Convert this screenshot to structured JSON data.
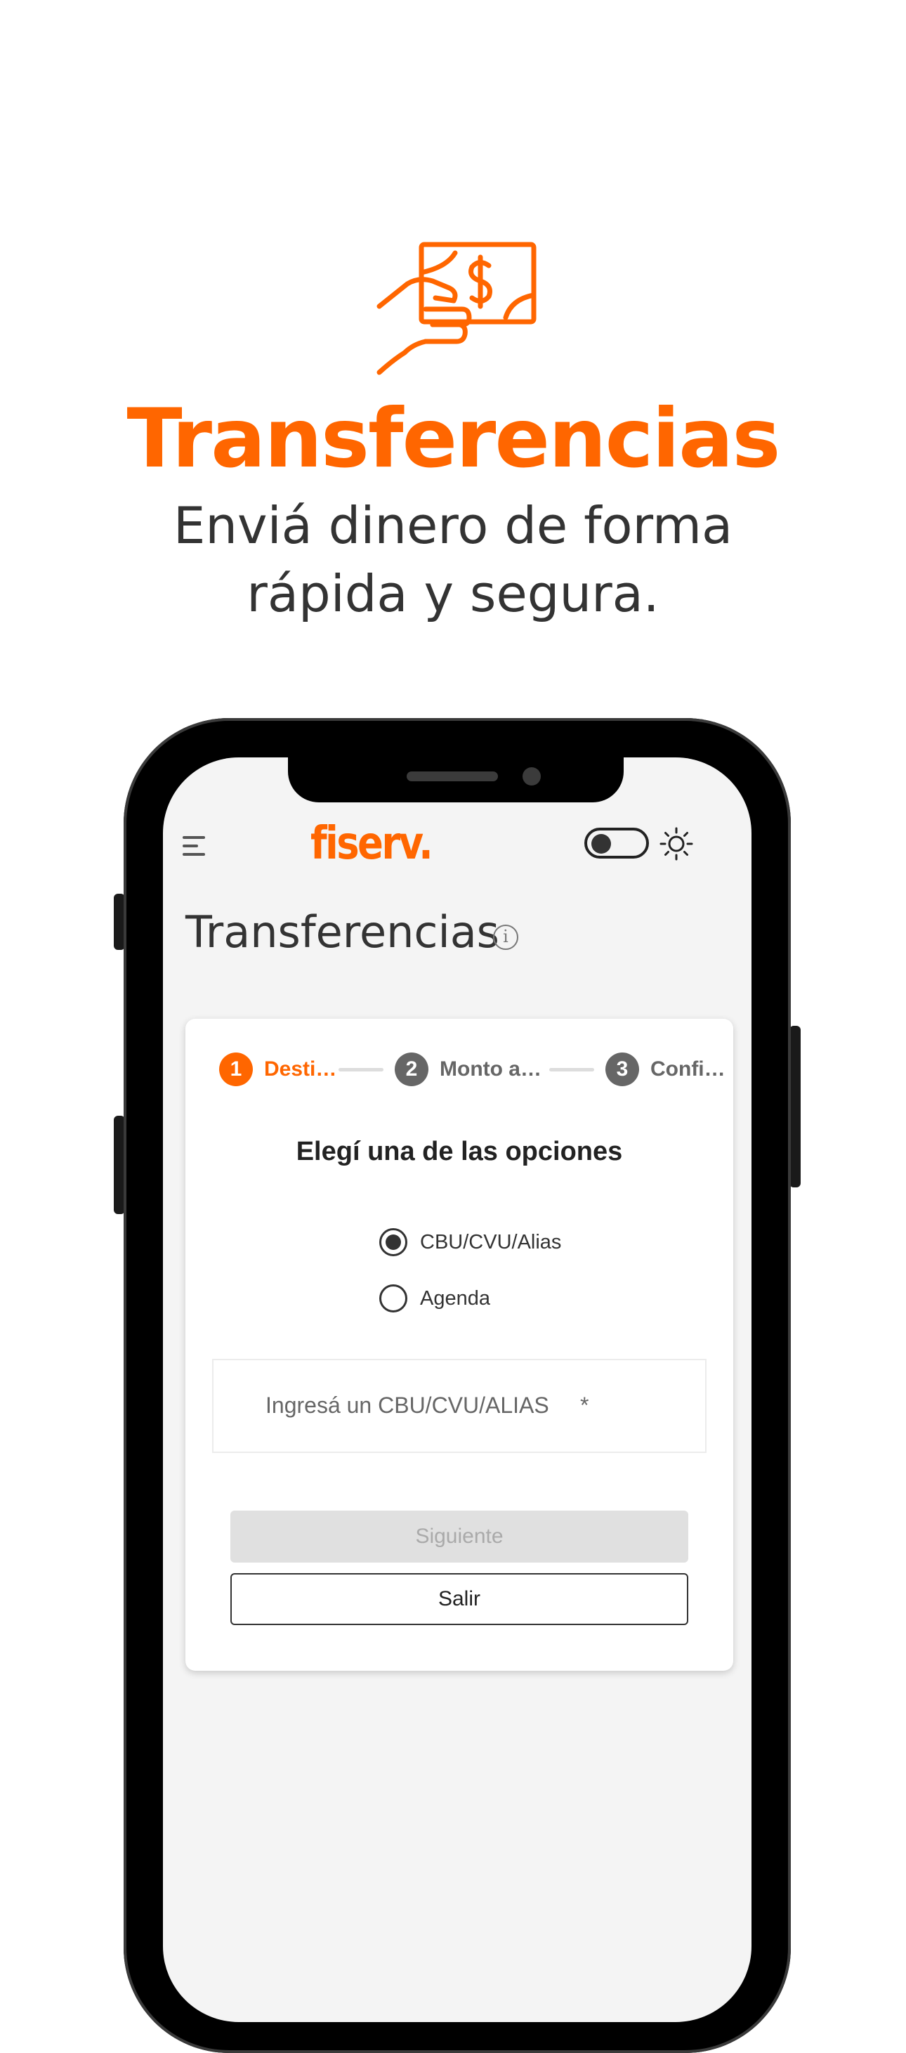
{
  "promo": {
    "icon": "hand-money-icon",
    "title": "Transferencias",
    "subtitle_line1": "Enviá dinero de forma",
    "subtitle_line2": "rápida y segura."
  },
  "app": {
    "logo": "fiserv.",
    "menu_icon": "hamburger-menu-icon",
    "theme_icon": "sun-icon",
    "page_title": "Transferencias",
    "info_symbol": "i"
  },
  "stepper": [
    {
      "number": "1",
      "label": "Desti…",
      "state": "active"
    },
    {
      "number": "2",
      "label": "Monto a…",
      "state": "inactive"
    },
    {
      "number": "3",
      "label": "Confi…",
      "state": "inactive"
    }
  ],
  "form": {
    "heading": "Elegí una de las opciones",
    "options": [
      {
        "label": "CBU/CVU/Alias",
        "selected": true
      },
      {
        "label": "Agenda",
        "selected": false
      }
    ],
    "input_placeholder": "Ingresá un CBU/CVU/ALIAS",
    "input_required_mark": "*",
    "next_button": "Siguiente",
    "exit_button": "Salir"
  },
  "colors": {
    "brand": "#ff6600",
    "inactive_step": "#666666",
    "disabled_button": "#e0e0e0"
  }
}
